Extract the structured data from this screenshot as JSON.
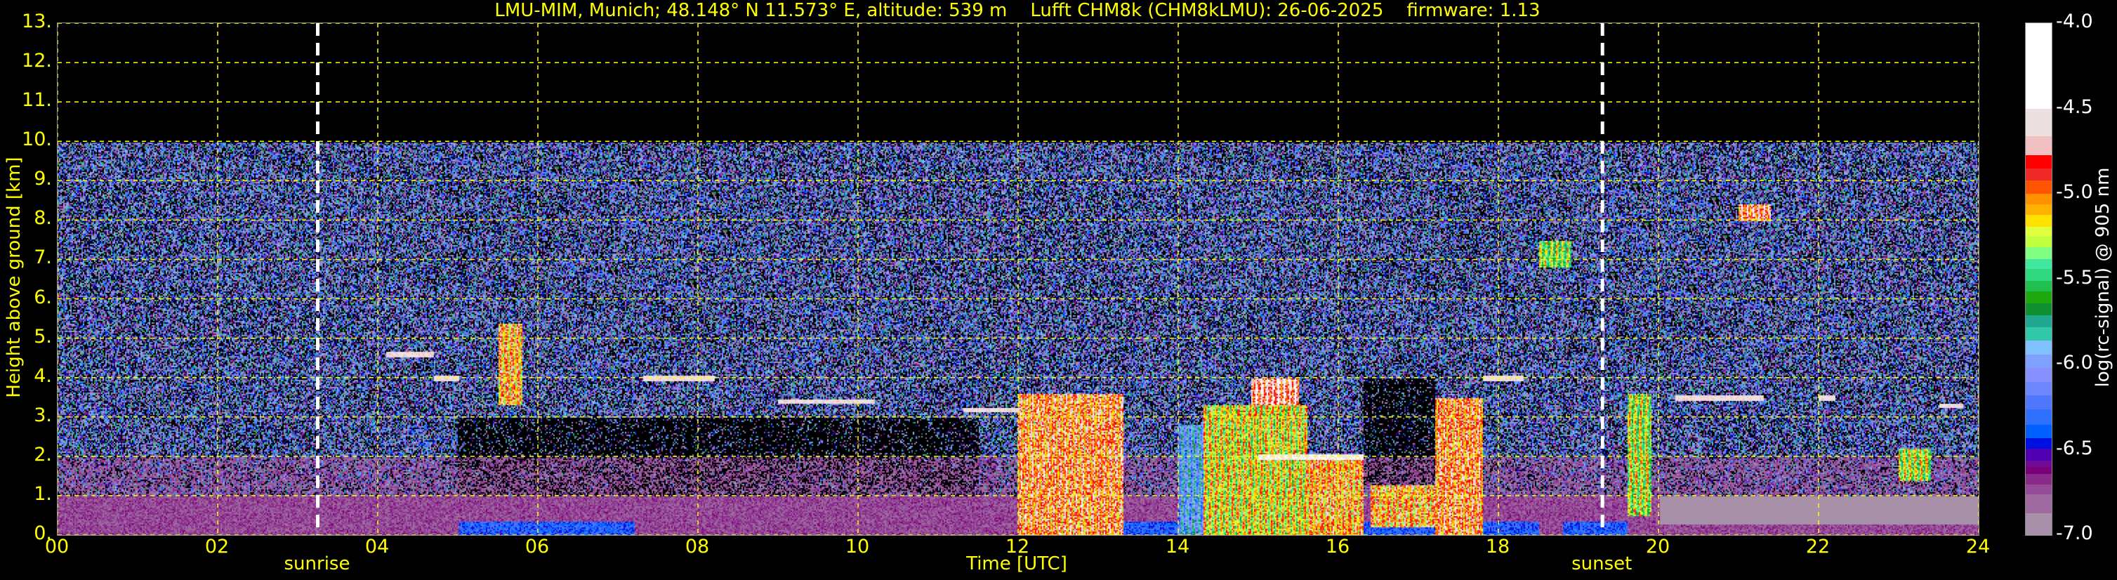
{
  "title": "LMU-MIM, Munich; 48.148° N 11.573° E, altitude: 539 m    Lufft CHM8k (CHM8kLMU): 26-06-2025    firmware: 1.13",
  "chart_data": {
    "type": "heatmap",
    "title": "LMU-MIM, Munich; 48.148° N 11.573° E, altitude: 539 m    Lufft CHM8k (CHM8kLMU): 26-06-2025    firmware: 1.13",
    "xlabel": "Time [UTC]",
    "ylabel": "Height above ground [km]",
    "xlim": [
      0,
      24
    ],
    "ylim": [
      0,
      13
    ],
    "data_top_km": 10,
    "xticks": [
      0,
      2,
      4,
      6,
      8,
      10,
      12,
      14,
      16,
      18,
      20,
      22,
      24
    ],
    "xtick_labels": [
      "00",
      "02",
      "04",
      "06",
      "08",
      "10",
      "12",
      "14",
      "16",
      "18",
      "20",
      "22",
      "24"
    ],
    "yticks": [
      0,
      1,
      2,
      3,
      4,
      5,
      6,
      7,
      8,
      9,
      10,
      11,
      12,
      13
    ],
    "ytick_labels": [
      "0.",
      "1.",
      "2.",
      "3.",
      "4.",
      "5.",
      "6.",
      "7.",
      "8.",
      "9.",
      "10.",
      "11.",
      "12.",
      "13."
    ],
    "grid": true,
    "grid_color": "#ffff00",
    "events": [
      {
        "label": "sunrise",
        "time": 3.25
      },
      {
        "label": "sunset",
        "time": 19.3
      }
    ],
    "colorbar": {
      "label": "log(rc-signal) @ 905 nm",
      "range": [
        -7.0,
        -4.0
      ],
      "ticks": [
        -4.0,
        -4.5,
        -5.0,
        -5.5,
        -6.0,
        -6.5,
        -7.0
      ],
      "tick_labels": [
        "-4.0",
        "-4.5",
        "-5.0",
        "-5.5",
        "-6.0",
        "-6.5",
        "-7.0"
      ],
      "segments": [
        [
          -7.0,
          "#a890a8"
        ],
        [
          -6.87,
          "#9e6aa0"
        ],
        [
          -6.76,
          "#944c98"
        ],
        [
          -6.7,
          "#8a2a8a"
        ],
        [
          -6.64,
          "#7a0078"
        ],
        [
          -6.6,
          "#6e0a98"
        ],
        [
          -6.56,
          "#5000b0"
        ],
        [
          -6.49,
          "#0010e0"
        ],
        [
          -6.43,
          "#0060ff"
        ],
        [
          -6.35,
          "#3070ff"
        ],
        [
          -6.26,
          "#5078ff"
        ],
        [
          -6.18,
          "#7088ff"
        ],
        [
          -6.1,
          "#8890ff"
        ],
        [
          -6.02,
          "#80a0ff"
        ],
        [
          -5.94,
          "#80c0ff"
        ],
        [
          -5.86,
          "#30c8a8"
        ],
        [
          -5.78,
          "#20a890"
        ],
        [
          -5.71,
          "#109030"
        ],
        [
          -5.64,
          "#20a810"
        ],
        [
          -5.57,
          "#20c050"
        ],
        [
          -5.51,
          "#30d880"
        ],
        [
          -5.44,
          "#40e8a0"
        ],
        [
          -5.38,
          "#80ff80"
        ],
        [
          -5.31,
          "#c0ff40"
        ],
        [
          -5.25,
          "#e0ff40"
        ],
        [
          -5.19,
          "#ffe000"
        ],
        [
          -5.12,
          "#ffb000"
        ],
        [
          -5.06,
          "#ff9000"
        ],
        [
          -5.0,
          "#ff5500"
        ],
        [
          -4.92,
          "#f02828"
        ],
        [
          -4.85,
          "#ff0000"
        ],
        [
          -4.77,
          "#f0c0c0"
        ],
        [
          -4.66,
          "#ece0e0"
        ],
        [
          -4.5,
          "#ffffff"
        ]
      ]
    },
    "cloud_features": [
      {
        "t0": 12.0,
        "t1": 13.3,
        "h0": 0.0,
        "h1": 3.6,
        "log": -4.9
      },
      {
        "t0": 14.0,
        "t1": 14.3,
        "h0": 0.0,
        "h1": 2.8,
        "log": -6.0
      },
      {
        "t0": 14.3,
        "t1": 15.6,
        "h0": 0.0,
        "h1": 3.3,
        "log": -5.2
      },
      {
        "t0": 14.9,
        "t1": 15.5,
        "h0": 3.3,
        "h1": 4.0,
        "log": -4.7
      },
      {
        "t0": 15.6,
        "t1": 16.3,
        "h0": 0.0,
        "h1": 2.0,
        "log": -5.0
      },
      {
        "t0": 16.4,
        "t1": 17.2,
        "h0": 0.2,
        "h1": 1.3,
        "log": -5.0
      },
      {
        "t0": 17.2,
        "t1": 17.8,
        "h0": 0.0,
        "h1": 3.5,
        "log": -4.9
      },
      {
        "t0": 18.5,
        "t1": 18.9,
        "h0": 6.8,
        "h1": 7.5,
        "log": -5.4
      },
      {
        "t0": 19.6,
        "t1": 19.9,
        "h0": 0.5,
        "h1": 3.6,
        "log": -5.3
      },
      {
        "t0": 21.0,
        "t1": 21.4,
        "h0": 8.0,
        "h1": 8.4,
        "log": -4.8
      },
      {
        "t0": 5.5,
        "t1": 5.8,
        "h0": 3.3,
        "h1": 5.4,
        "log": -5.0
      },
      {
        "t0": 23.0,
        "t1": 23.4,
        "h0": 1.4,
        "h1": 2.2,
        "log": -5.3
      }
    ],
    "thin_layers": [
      {
        "t0": 4.1,
        "t1": 4.7,
        "h": 4.6,
        "log": -4.6
      },
      {
        "t0": 4.7,
        "t1": 5.0,
        "h": 4.0,
        "log": -4.6
      },
      {
        "t0": 7.3,
        "t1": 8.2,
        "h": 4.0,
        "log": -4.6
      },
      {
        "t0": 9.0,
        "t1": 10.2,
        "h": 3.4,
        "log": -4.6
      },
      {
        "t0": 11.3,
        "t1": 12.0,
        "h": 3.2,
        "log": -4.6
      },
      {
        "t0": 15.0,
        "t1": 16.3,
        "h": 2.0,
        "log": -4.5
      },
      {
        "t0": 17.8,
        "t1": 18.3,
        "h": 4.0,
        "log": -4.6
      },
      {
        "t0": 20.2,
        "t1": 21.3,
        "h": 3.5,
        "log": -4.6
      },
      {
        "t0": 22.0,
        "t1": 22.2,
        "h": 3.5,
        "log": -4.6
      },
      {
        "t0": 23.5,
        "t1": 23.8,
        "h": 3.3,
        "log": -4.6
      }
    ],
    "quiet_regions": [
      {
        "t0": 16.3,
        "t1": 17.2,
        "h0": 1.3,
        "h1": 4.0
      },
      {
        "t0": 5.0,
        "t1": 11.5,
        "h0": 1.0,
        "h1": 3.0
      }
    ]
  }
}
